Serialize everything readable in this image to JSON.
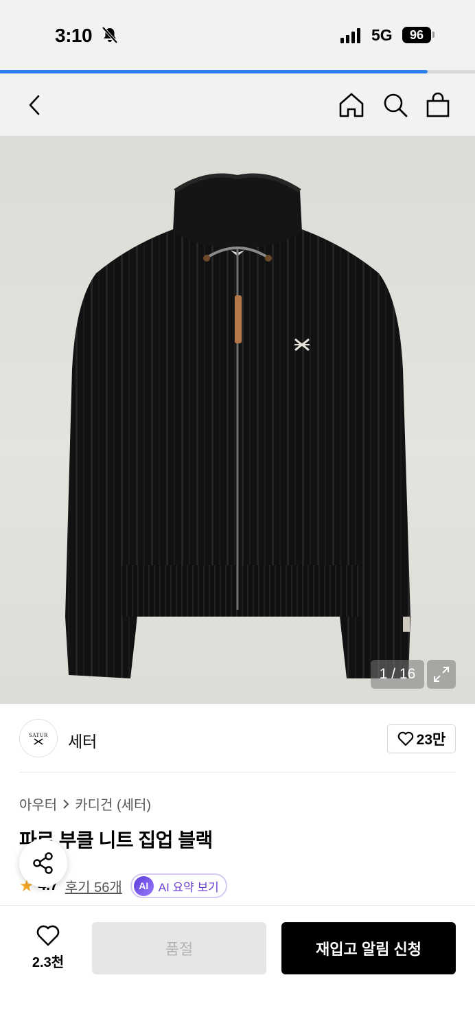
{
  "status_bar": {
    "time": "3:10",
    "network": "5G",
    "battery": "96"
  },
  "load_progress": 0.9,
  "nav": {
    "icons": [
      "back-icon",
      "home-icon",
      "search-icon",
      "shopping-bag-icon"
    ]
  },
  "gallery": {
    "counter": "1 / 16"
  },
  "brand": {
    "logo_text": "SATUR",
    "name": "세터",
    "like_count": "23만"
  },
  "breadcrumb": {
    "category": "아우터",
    "subcategory": "카디건 (세터)"
  },
  "product": {
    "title": "파르 부클 니트 집업 블랙"
  },
  "rating": {
    "value": "4.7",
    "reviews_label": "후기 56개",
    "ai_badge": "AI",
    "ai_label": "AI 요약 보기"
  },
  "bottom": {
    "like_count": "2.3천",
    "soldout_label": "품절",
    "restock_label": "재입고 알림 신청"
  },
  "colors": {
    "accent": "#2f80ed",
    "star": "#f5a623",
    "ai": "#6a3fd0"
  }
}
